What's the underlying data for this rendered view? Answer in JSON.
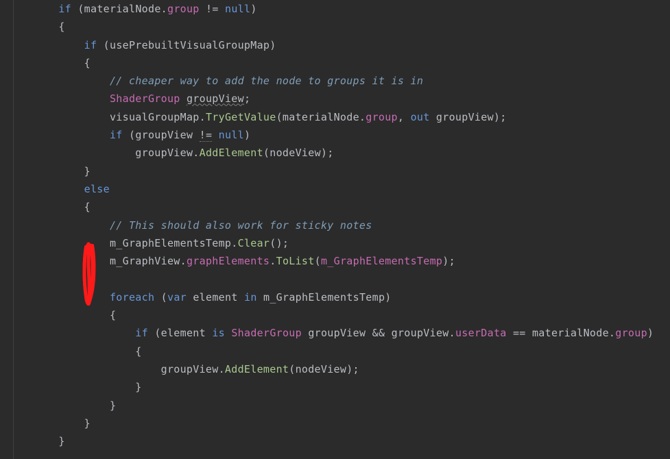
{
  "code": {
    "t01": "if",
    "t02": "(materialNode.",
    "t03": "group",
    "t04": "!=",
    "t05": "null",
    "t06": ")",
    "t07": "{",
    "t08": "if",
    "t09": "(usePrebuiltVisualGroupMap)",
    "t10": "{",
    "t11": "// cheaper way to add the node to groups it is in",
    "t12": "ShaderGroup",
    "t13": "groupView",
    "t14": ";",
    "t15": "visualGroupMap",
    "t16": ".",
    "t17": "TryGetValue",
    "t18": "(materialNode.",
    "t19": "group",
    "t20": ",",
    "t21": "out",
    "t22": "groupView);",
    "t23": "if",
    "t24": "(groupView",
    "t25": "!=",
    "t26": "null",
    "t27": ")",
    "t28": "groupView.",
    "t29": "AddElement",
    "t30": "(nodeView);",
    "t31": "}",
    "t32": "else",
    "t33": "{",
    "t34": "// This should also work for sticky notes",
    "t35": "m_GraphElementsTemp",
    "t36": ".",
    "t37": "Clear",
    "t38": "();",
    "t39": "m_GraphView",
    "t40": ".",
    "t41": "graphElements",
    "t42": ".",
    "t43": "ToList",
    "t44": "(",
    "t45": "m_GraphElementsTemp",
    "t46": ");",
    "t47": "foreach",
    "t48": "(",
    "t49": "var",
    "t50": "element",
    "t51": "in",
    "t52": "m_GraphElementsTemp)",
    "t53": "{",
    "t54": "if",
    "t55": "(element",
    "t56": "is",
    "t57": "ShaderGroup",
    "t58": "groupView &&",
    "t59": "groupView.",
    "t60": "userData",
    "t61": "== materialNode.",
    "t62": "group",
    "t63": ")",
    "t64": "{",
    "t65": "groupView.",
    "t66": "AddElement",
    "t67": "(nodeView);",
    "t68": "}",
    "t69": "}",
    "t70": "}",
    "t71": "}"
  },
  "annotation": {
    "color": "#ff1a1a"
  }
}
